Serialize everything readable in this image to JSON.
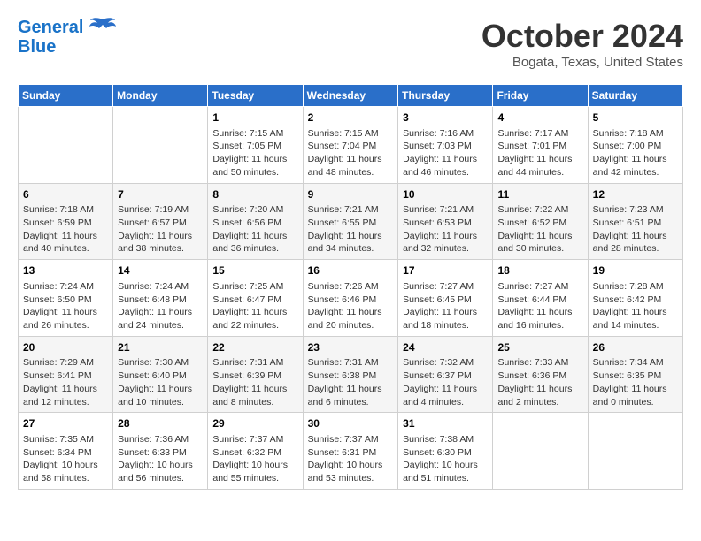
{
  "header": {
    "logo_line1": "General",
    "logo_line2": "Blue",
    "month_title": "October 2024",
    "subtitle": "Bogata, Texas, United States"
  },
  "weekdays": [
    "Sunday",
    "Monday",
    "Tuesday",
    "Wednesday",
    "Thursday",
    "Friday",
    "Saturday"
  ],
  "weeks": [
    [
      {
        "day": "",
        "info": ""
      },
      {
        "day": "",
        "info": ""
      },
      {
        "day": "1",
        "info": "Sunrise: 7:15 AM\nSunset: 7:05 PM\nDaylight: 11 hours and 50 minutes."
      },
      {
        "day": "2",
        "info": "Sunrise: 7:15 AM\nSunset: 7:04 PM\nDaylight: 11 hours and 48 minutes."
      },
      {
        "day": "3",
        "info": "Sunrise: 7:16 AM\nSunset: 7:03 PM\nDaylight: 11 hours and 46 minutes."
      },
      {
        "day": "4",
        "info": "Sunrise: 7:17 AM\nSunset: 7:01 PM\nDaylight: 11 hours and 44 minutes."
      },
      {
        "day": "5",
        "info": "Sunrise: 7:18 AM\nSunset: 7:00 PM\nDaylight: 11 hours and 42 minutes."
      }
    ],
    [
      {
        "day": "6",
        "info": "Sunrise: 7:18 AM\nSunset: 6:59 PM\nDaylight: 11 hours and 40 minutes."
      },
      {
        "day": "7",
        "info": "Sunrise: 7:19 AM\nSunset: 6:57 PM\nDaylight: 11 hours and 38 minutes."
      },
      {
        "day": "8",
        "info": "Sunrise: 7:20 AM\nSunset: 6:56 PM\nDaylight: 11 hours and 36 minutes."
      },
      {
        "day": "9",
        "info": "Sunrise: 7:21 AM\nSunset: 6:55 PM\nDaylight: 11 hours and 34 minutes."
      },
      {
        "day": "10",
        "info": "Sunrise: 7:21 AM\nSunset: 6:53 PM\nDaylight: 11 hours and 32 minutes."
      },
      {
        "day": "11",
        "info": "Sunrise: 7:22 AM\nSunset: 6:52 PM\nDaylight: 11 hours and 30 minutes."
      },
      {
        "day": "12",
        "info": "Sunrise: 7:23 AM\nSunset: 6:51 PM\nDaylight: 11 hours and 28 minutes."
      }
    ],
    [
      {
        "day": "13",
        "info": "Sunrise: 7:24 AM\nSunset: 6:50 PM\nDaylight: 11 hours and 26 minutes."
      },
      {
        "day": "14",
        "info": "Sunrise: 7:24 AM\nSunset: 6:48 PM\nDaylight: 11 hours and 24 minutes."
      },
      {
        "day": "15",
        "info": "Sunrise: 7:25 AM\nSunset: 6:47 PM\nDaylight: 11 hours and 22 minutes."
      },
      {
        "day": "16",
        "info": "Sunrise: 7:26 AM\nSunset: 6:46 PM\nDaylight: 11 hours and 20 minutes."
      },
      {
        "day": "17",
        "info": "Sunrise: 7:27 AM\nSunset: 6:45 PM\nDaylight: 11 hours and 18 minutes."
      },
      {
        "day": "18",
        "info": "Sunrise: 7:27 AM\nSunset: 6:44 PM\nDaylight: 11 hours and 16 minutes."
      },
      {
        "day": "19",
        "info": "Sunrise: 7:28 AM\nSunset: 6:42 PM\nDaylight: 11 hours and 14 minutes."
      }
    ],
    [
      {
        "day": "20",
        "info": "Sunrise: 7:29 AM\nSunset: 6:41 PM\nDaylight: 11 hours and 12 minutes."
      },
      {
        "day": "21",
        "info": "Sunrise: 7:30 AM\nSunset: 6:40 PM\nDaylight: 11 hours and 10 minutes."
      },
      {
        "day": "22",
        "info": "Sunrise: 7:31 AM\nSunset: 6:39 PM\nDaylight: 11 hours and 8 minutes."
      },
      {
        "day": "23",
        "info": "Sunrise: 7:31 AM\nSunset: 6:38 PM\nDaylight: 11 hours and 6 minutes."
      },
      {
        "day": "24",
        "info": "Sunrise: 7:32 AM\nSunset: 6:37 PM\nDaylight: 11 hours and 4 minutes."
      },
      {
        "day": "25",
        "info": "Sunrise: 7:33 AM\nSunset: 6:36 PM\nDaylight: 11 hours and 2 minutes."
      },
      {
        "day": "26",
        "info": "Sunrise: 7:34 AM\nSunset: 6:35 PM\nDaylight: 11 hours and 0 minutes."
      }
    ],
    [
      {
        "day": "27",
        "info": "Sunrise: 7:35 AM\nSunset: 6:34 PM\nDaylight: 10 hours and 58 minutes."
      },
      {
        "day": "28",
        "info": "Sunrise: 7:36 AM\nSunset: 6:33 PM\nDaylight: 10 hours and 56 minutes."
      },
      {
        "day": "29",
        "info": "Sunrise: 7:37 AM\nSunset: 6:32 PM\nDaylight: 10 hours and 55 minutes."
      },
      {
        "day": "30",
        "info": "Sunrise: 7:37 AM\nSunset: 6:31 PM\nDaylight: 10 hours and 53 minutes."
      },
      {
        "day": "31",
        "info": "Sunrise: 7:38 AM\nSunset: 6:30 PM\nDaylight: 10 hours and 51 minutes."
      },
      {
        "day": "",
        "info": ""
      },
      {
        "day": "",
        "info": ""
      }
    ]
  ]
}
